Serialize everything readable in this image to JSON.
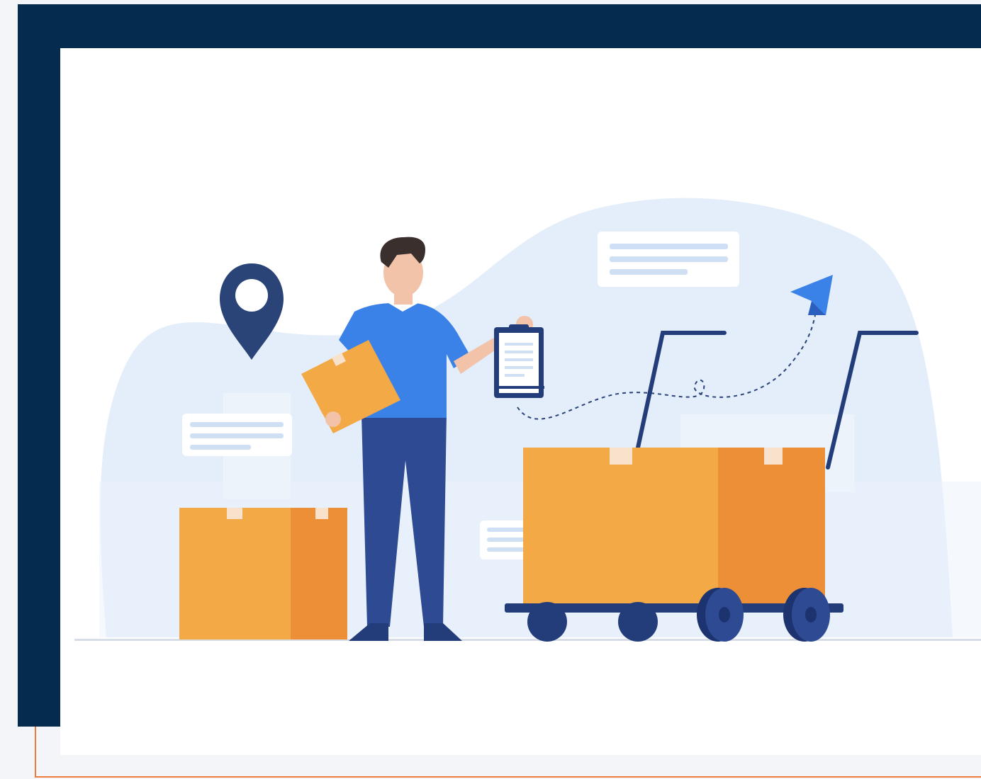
{
  "colors": {
    "navy_frame": "#052c4f",
    "orange_accent": "#ee7c3a",
    "blob": "#e3eefa",
    "blob_light": "#edf3fb",
    "box_light": "#f2a946",
    "box_dark": "#ed8f37",
    "box_tape": "#f8e2cc",
    "shirt": "#3b82e8",
    "pants": "#2d4a92",
    "hair": "#3a2f2c",
    "skin": "#f2c3a8",
    "dark_navy": "#233d7a",
    "pin": "#2a4478",
    "plane_blue": "#3b82e8",
    "card_white": "#ffffff",
    "card_line": "#cfe0f4",
    "ground": "#d7dde6"
  },
  "illustration": {
    "subject": "delivery-worker-with-boxes-and-cart",
    "icons": [
      "location-pin-icon",
      "clipboard-icon",
      "paper-plane-icon",
      "info-card-icon"
    ]
  }
}
